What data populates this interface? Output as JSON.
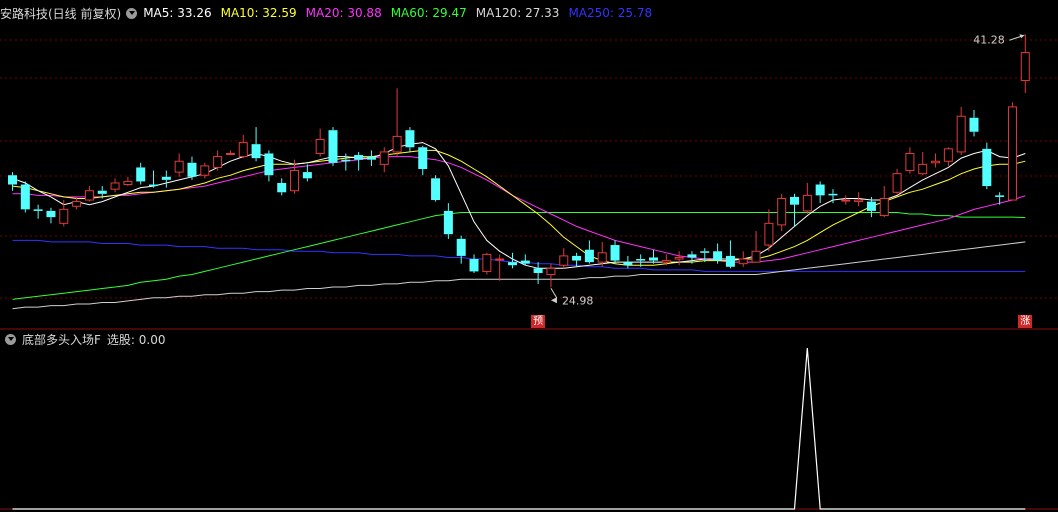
{
  "header": {
    "stock": "安路科技(日线 前复权)",
    "ma": [
      {
        "label": "MA5: 33.26",
        "color": "#ffffff"
      },
      {
        "label": "MA10: 32.59",
        "color": "#ffff33"
      },
      {
        "label": "MA20: 30.88",
        "color": "#ff33ff"
      },
      {
        "label": "MA60: 29.47",
        "color": "#33ff33"
      },
      {
        "label": "MA120: 27.33",
        "color": "#d8d8d8"
      },
      {
        "label": "MA250: 25.78",
        "color": "#3333ff"
      }
    ]
  },
  "indicator": {
    "title": "底部多头入场F",
    "value_label": "选股: 0.00"
  },
  "annotations": {
    "high": "41.28",
    "low": "24.98",
    "tag_yu": "预",
    "tag_zhang": "涨"
  },
  "colors": {
    "up": "#e03a3a",
    "down": "#54ffff",
    "grid": "#7a0000",
    "divider": "#8a1010",
    "ma5": "#ffffff",
    "ma10": "#ffff33",
    "ma20": "#ff33ff",
    "ma60": "#33ff33",
    "ma120": "#cfcfcf",
    "ma250": "#3333ff",
    "signal": "#ffffff"
  },
  "chart_data": {
    "type": "candlestick",
    "candles": [
      [
        32.2,
        31.6,
        32.4,
        31.2
      ],
      [
        31.6,
        30.0,
        31.8,
        29.8
      ],
      [
        30.0,
        29.9,
        30.3,
        29.4
      ],
      [
        29.9,
        29.5,
        30.1,
        29.1
      ],
      [
        29.1,
        30.0,
        30.6,
        28.9
      ],
      [
        30.2,
        30.5,
        30.8,
        30.0
      ],
      [
        30.6,
        31.2,
        31.5,
        30.5
      ],
      [
        31.2,
        31.0,
        31.5,
        30.7
      ],
      [
        31.3,
        31.7,
        32.0,
        31.1
      ],
      [
        31.6,
        31.8,
        32.1,
        31.5
      ],
      [
        32.7,
        31.8,
        33.0,
        31.6
      ],
      [
        31.6,
        31.5,
        32.5,
        31.4
      ],
      [
        32.1,
        31.9,
        32.5,
        31.4
      ],
      [
        32.4,
        33.1,
        33.6,
        32.1
      ],
      [
        33.0,
        32.1,
        33.4,
        31.9
      ],
      [
        32.2,
        32.8,
        33.0,
        32.0
      ],
      [
        32.7,
        33.4,
        33.8,
        32.5
      ],
      [
        33.6,
        33.6,
        33.8,
        33.5
      ],
      [
        33.4,
        34.3,
        34.8,
        33.3
      ],
      [
        34.2,
        33.3,
        35.3,
        33.1
      ],
      [
        33.6,
        32.2,
        33.8,
        31.8
      ],
      [
        31.7,
        31.1,
        32.0,
        30.9
      ],
      [
        31.2,
        32.5,
        33.2,
        31.0
      ],
      [
        32.4,
        32.0,
        32.9,
        31.8
      ],
      [
        33.6,
        34.5,
        35.2,
        33.4
      ],
      [
        35.1,
        33.0,
        35.3,
        32.8
      ],
      [
        33.2,
        33.1,
        33.6,
        32.5
      ],
      [
        33.5,
        33.2,
        33.7,
        32.5
      ],
      [
        33.4,
        33.2,
        33.8,
        32.8
      ],
      [
        32.9,
        33.7,
        34.0,
        32.4
      ],
      [
        33.7,
        34.7,
        37.8,
        33.4
      ],
      [
        35.1,
        34.0,
        35.3,
        33.7
      ],
      [
        34.0,
        32.6,
        34.1,
        32.2
      ],
      [
        32.0,
        30.6,
        32.2,
        30.5
      ],
      [
        29.9,
        28.4,
        30.4,
        28.1
      ],
      [
        28.1,
        27.0,
        28.3,
        26.5
      ],
      [
        26.8,
        26.0,
        27.1,
        25.9
      ],
      [
        26.0,
        27.1,
        27.2,
        25.8
      ],
      [
        26.8,
        26.8,
        27.1,
        25.4
      ],
      [
        26.6,
        26.4,
        27.2,
        26.2
      ],
      [
        26.7,
        26.5,
        27.1,
        26.4
      ],
      [
        26.2,
        25.9,
        26.6,
        25.2
      ],
      [
        25.8,
        26.2,
        26.5,
        24.98
      ],
      [
        26.4,
        27.0,
        27.5,
        26.2
      ],
      [
        27.0,
        26.7,
        27.2,
        26.3
      ],
      [
        27.4,
        26.6,
        28.0,
        26.5
      ],
      [
        26.6,
        27.2,
        27.9,
        26.3
      ],
      [
        27.7,
        26.7,
        28.0,
        26.5
      ],
      [
        26.6,
        26.4,
        27.0,
        26.2
      ],
      [
        26.8,
        26.7,
        27.1,
        26.3
      ],
      [
        26.9,
        26.7,
        27.4,
        26.5
      ],
      [
        26.6,
        26.7,
        27.1,
        26.4
      ],
      [
        26.8,
        26.9,
        27.3,
        26.4
      ],
      [
        27.1,
        26.9,
        27.3,
        26.5
      ],
      [
        27.3,
        27.2,
        27.5,
        26.6
      ],
      [
        27.3,
        26.7,
        27.8,
        26.5
      ],
      [
        27.0,
        26.3,
        28.0,
        26.2
      ],
      [
        26.5,
        26.8,
        27.3,
        26.3
      ],
      [
        26.6,
        27.3,
        28.6,
        26.6
      ],
      [
        27.7,
        29.1,
        30.0,
        27.3
      ],
      [
        29.0,
        30.7,
        31.0,
        28.6
      ],
      [
        30.8,
        30.3,
        31.0,
        28.9
      ],
      [
        29.9,
        30.9,
        31.7,
        29.7
      ],
      [
        31.6,
        30.9,
        31.8,
        30.4
      ],
      [
        31.0,
        30.9,
        31.3,
        30.4
      ],
      [
        30.6,
        30.6,
        30.9,
        30.3
      ],
      [
        30.5,
        30.6,
        31.1,
        30.2
      ],
      [
        30.5,
        29.9,
        30.8,
        29.5
      ],
      [
        29.6,
        30.7,
        31.5,
        29.5
      ],
      [
        31.1,
        32.3,
        32.6,
        31.0
      ],
      [
        32.5,
        33.6,
        34.0,
        32.3
      ],
      [
        32.3,
        32.9,
        33.7,
        32.2
      ],
      [
        33.0,
        33.1,
        33.6,
        32.7
      ],
      [
        33.1,
        33.9,
        34.0,
        32.8
      ],
      [
        33.7,
        36.0,
        36.6,
        33.5
      ],
      [
        35.9,
        35.0,
        36.4,
        34.7
      ],
      [
        33.9,
        31.5,
        34.3,
        31.3
      ],
      [
        30.9,
        30.8,
        31.1,
        30.3
      ],
      [
        30.6,
        36.6,
        36.9,
        30.6
      ],
      [
        38.3,
        40.1,
        41.28,
        37.5
      ]
    ],
    "ma5": [
      32.0,
      31.7,
      31.2,
      30.8,
      30.3,
      30.5,
      30.3,
      30.5,
      30.8,
      31.1,
      31.4,
      31.5,
      31.7,
      31.9,
      32.1,
      32.3,
      32.7,
      33.1,
      33.4,
      33.6,
      33.4,
      33.1,
      32.9,
      33.0,
      33.2,
      33.4,
      33.4,
      33.3,
      33.3,
      33.6,
      34.0,
      34.2,
      34.3,
      33.9,
      32.8,
      31.0,
      29.2,
      28.0,
      27.3,
      26.8,
      26.4,
      26.2,
      26.2,
      26.2,
      26.3,
      26.4,
      26.5,
      26.6,
      26.6,
      26.6,
      26.6,
      26.6,
      26.6,
      26.7,
      26.8,
      26.8,
      26.8,
      26.8,
      27.0,
      27.5,
      28.2,
      28.9,
      29.6,
      30.2,
      30.6,
      30.7,
      30.7,
      30.6,
      30.6,
      30.9,
      31.4,
      31.9,
      32.3,
      32.7,
      33.3,
      33.6,
      33.8,
      33.4,
      33.3,
      33.6
    ],
    "ma10": [
      31.5,
      31.4,
      31.2,
      31.0,
      30.8,
      30.7,
      30.7,
      30.8,
      30.9,
      31.0,
      31.1,
      31.1,
      31.2,
      31.3,
      31.5,
      31.7,
      32.0,
      32.2,
      32.5,
      32.7,
      32.9,
      32.9,
      32.9,
      33.0,
      33.1,
      33.2,
      33.3,
      33.4,
      33.4,
      33.5,
      33.6,
      33.7,
      33.8,
      33.8,
      33.5,
      33.1,
      32.6,
      32.1,
      31.5,
      30.9,
      30.3,
      29.7,
      29.0,
      28.2,
      27.6,
      27.0,
      26.7,
      26.5,
      26.4,
      26.4,
      26.4,
      26.5,
      26.6,
      26.6,
      26.7,
      26.7,
      26.7,
      26.8,
      26.8,
      27.0,
      27.3,
      27.6,
      28.0,
      28.5,
      29.0,
      29.4,
      29.8,
      30.2,
      30.5,
      30.8,
      31.1,
      31.3,
      31.6,
      31.9,
      32.3,
      32.6,
      32.8,
      32.9,
      32.9,
      33.1
    ],
    "ma20": [
      31.0,
      31.0,
      30.9,
      30.9,
      30.8,
      30.8,
      30.8,
      30.8,
      30.9,
      30.9,
      31.0,
      31.1,
      31.2,
      31.3,
      31.4,
      31.5,
      31.7,
      31.9,
      32.1,
      32.3,
      32.5,
      32.6,
      32.7,
      32.8,
      32.9,
      33.0,
      33.1,
      33.2,
      33.3,
      33.4,
      33.4,
      33.4,
      33.3,
      33.2,
      33.0,
      32.7,
      32.3,
      31.9,
      31.4,
      30.9,
      30.5,
      30.1,
      29.7,
      29.3,
      28.9,
      28.6,
      28.3,
      28.0,
      27.8,
      27.6,
      27.4,
      27.2,
      27.0,
      26.9,
      26.8,
      26.7,
      26.6,
      26.6,
      26.6,
      26.7,
      26.8,
      27.0,
      27.2,
      27.4,
      27.6,
      27.8,
      28.0,
      28.2,
      28.4,
      28.6,
      28.8,
      29.0,
      29.2,
      29.4,
      29.7,
      30.0,
      30.2,
      30.4,
      30.6,
      30.88
    ],
    "ma60": [
      24.2,
      24.3,
      24.4,
      24.5,
      24.6,
      24.7,
      24.8,
      24.9,
      25.0,
      25.1,
      25.3,
      25.4,
      25.5,
      25.7,
      25.8,
      26.0,
      26.2,
      26.4,
      26.6,
      26.8,
      27.0,
      27.2,
      27.4,
      27.6,
      27.8,
      28.0,
      28.2,
      28.4,
      28.6,
      28.8,
      29.0,
      29.2,
      29.4,
      29.6,
      29.7,
      29.8,
      29.8,
      29.8,
      29.8,
      29.8,
      29.8,
      29.8,
      29.8,
      29.8,
      29.8,
      29.8,
      29.8,
      29.8,
      29.8,
      29.8,
      29.8,
      29.8,
      29.8,
      29.8,
      29.8,
      29.8,
      29.8,
      29.8,
      29.8,
      29.8,
      29.8,
      29.8,
      29.8,
      29.8,
      29.8,
      29.8,
      29.8,
      29.8,
      29.8,
      29.8,
      29.7,
      29.7,
      29.6,
      29.6,
      29.5,
      29.5,
      29.5,
      29.5,
      29.5,
      29.47
    ],
    "ma120": [
      23.6,
      23.7,
      23.7,
      23.8,
      23.8,
      23.9,
      23.9,
      24.0,
      24.0,
      24.1,
      24.2,
      24.3,
      24.3,
      24.4,
      24.4,
      24.5,
      24.5,
      24.6,
      24.6,
      24.7,
      24.7,
      24.8,
      24.8,
      24.9,
      24.9,
      25.0,
      25.0,
      25.1,
      25.1,
      25.2,
      25.2,
      25.3,
      25.3,
      25.4,
      25.4,
      25.5,
      25.5,
      25.5,
      25.5,
      25.5,
      25.5,
      25.5,
      25.5,
      25.5,
      25.5,
      25.6,
      25.6,
      25.7,
      25.7,
      25.8,
      25.8,
      25.8,
      25.8,
      25.8,
      25.8,
      25.8,
      25.8,
      25.8,
      25.8,
      25.9,
      26.0,
      26.1,
      26.2,
      26.3,
      26.4,
      26.5,
      26.6,
      26.7,
      26.8,
      26.9,
      27.0,
      27.1,
      27.2,
      27.3,
      27.4,
      27.5,
      27.6,
      27.7,
      27.8,
      27.9
    ],
    "ma250": [
      28.0,
      28.0,
      28.0,
      27.9,
      27.9,
      27.9,
      27.9,
      27.8,
      27.8,
      27.8,
      27.7,
      27.7,
      27.7,
      27.6,
      27.6,
      27.6,
      27.5,
      27.5,
      27.5,
      27.4,
      27.4,
      27.4,
      27.3,
      27.3,
      27.3,
      27.2,
      27.2,
      27.2,
      27.1,
      27.1,
      27.1,
      27.0,
      27.0,
      27.0,
      26.9,
      26.9,
      26.8,
      26.8,
      26.7,
      26.6,
      26.6,
      26.5,
      26.5,
      26.4,
      26.4,
      26.3,
      26.3,
      26.2,
      26.2,
      26.2,
      26.1,
      26.1,
      26.1,
      26.1,
      26.0,
      26.0,
      26.0,
      26.0,
      26.0,
      26.0,
      26.0,
      26.0,
      26.0,
      26.0,
      26.0,
      26.0,
      26.0,
      26.0,
      26.0,
      26.0,
      26.0,
      26.0,
      26.0,
      26.0,
      26.0,
      26.0,
      26.0,
      26.0,
      26.0,
      26.0
    ],
    "signal": [
      0,
      0,
      0,
      0,
      0,
      0,
      0,
      0,
      0,
      0,
      0,
      0,
      0,
      0,
      0,
      0,
      0,
      0,
      0,
      0,
      0,
      0,
      0,
      0,
      0,
      0,
      0,
      0,
      0,
      0,
      0,
      0,
      0,
      0,
      0,
      0,
      0,
      0,
      0,
      0,
      0,
      0,
      0,
      0,
      0,
      0,
      0,
      0,
      0,
      0,
      0,
      0,
      0,
      0,
      0,
      0,
      0,
      0,
      0,
      0,
      0,
      0,
      1,
      0,
      0,
      0,
      0,
      0,
      0,
      0,
      0,
      0,
      0,
      0,
      0,
      0,
      0,
      0,
      0,
      0
    ],
    "high_index": 79,
    "low_index": 42,
    "yu_index": 41,
    "zhang_index": 79
  }
}
